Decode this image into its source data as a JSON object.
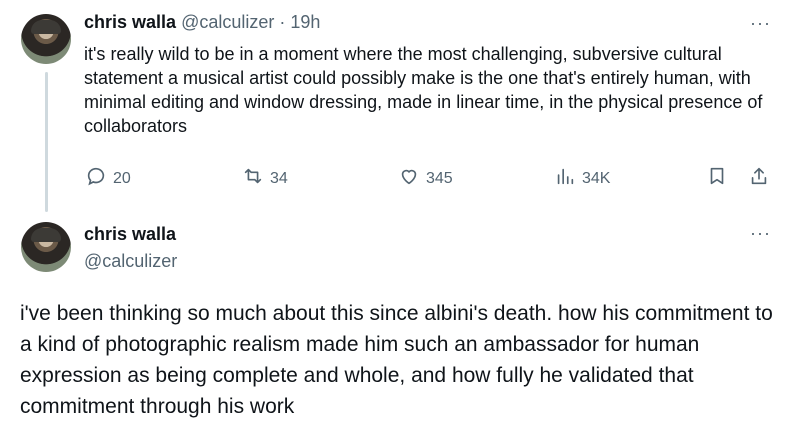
{
  "tweet1": {
    "author_name": "chris walla",
    "handle": "@calculizer",
    "separator": "·",
    "time": "19h",
    "text": "it's really wild to be in a moment where the most challenging, subversive cultural statement a musical artist could possibly make is the one that's entirely human, with minimal editing and window dressing, made in linear time, in the physical presence of collaborators",
    "actions": {
      "replies": "20",
      "reposts": "34",
      "likes": "345",
      "views": "34K"
    }
  },
  "tweet2": {
    "author_name": "chris walla",
    "handle": "@calculizer",
    "text": "i've been thinking so much about this since albini's death.  how his commitment to a kind of photographic realism made him such an ambassador for human expression as being complete and whole, and how fully he validated that commitment through his work"
  },
  "more_glyph": "···",
  "icons": [
    "reply-icon",
    "repost-icon",
    "like-icon",
    "views-icon",
    "bookmark-icon",
    "share-icon",
    "more-icon"
  ],
  "colors": {
    "text": "#0f1419",
    "muted": "#536471",
    "thread_line": "#cfd9de"
  }
}
